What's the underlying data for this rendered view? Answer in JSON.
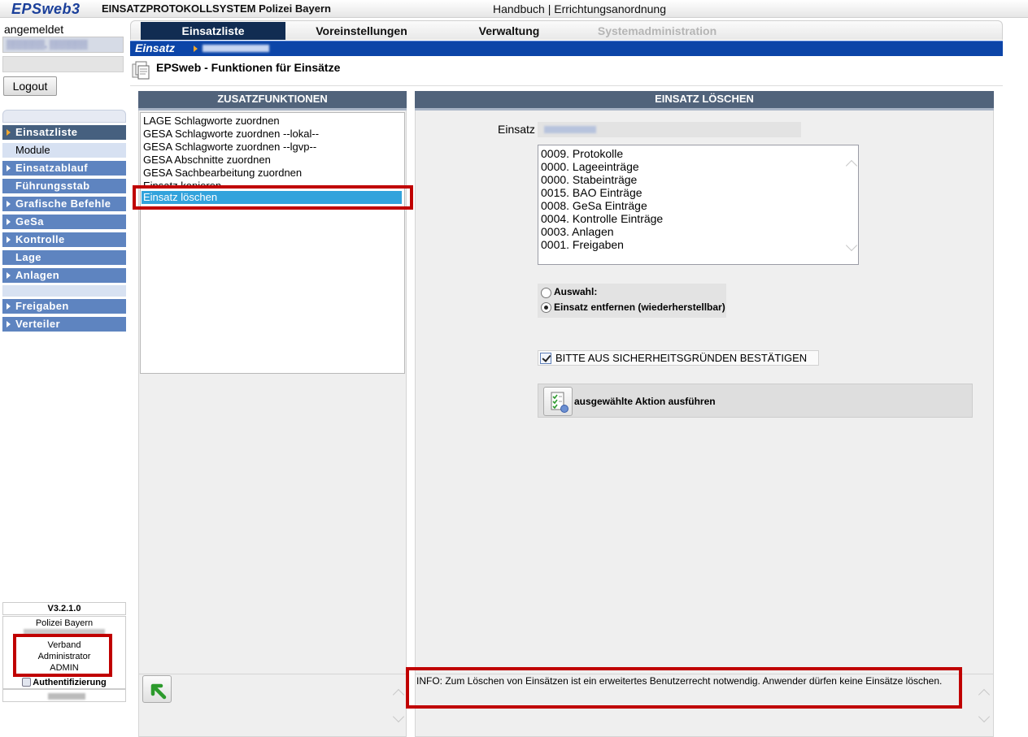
{
  "header": {
    "logo": "EPSweb3",
    "system_title": "EINSATZPROTOKOLLSYSTEM Polizei Bayern",
    "link_handbuch": "Handbuch",
    "link_separator": " | ",
    "link_errichtung": "Errichtungsanordnung"
  },
  "sidebar": {
    "login_label": "angemeldet",
    "logout_label": "Logout",
    "nav": [
      {
        "label": "Einsatzliste"
      },
      {
        "label": "Module"
      },
      {
        "label": "Einsatzablauf"
      },
      {
        "label": "Führungsstab"
      },
      {
        "label": "Grafische Befehle"
      },
      {
        "label": "GeSa"
      },
      {
        "label": "Kontrolle"
      },
      {
        "label": "Lage"
      },
      {
        "label": "Anlagen"
      },
      {
        "label": "Freigaben"
      },
      {
        "label": "Verteiler"
      }
    ],
    "version": "V3.2.1.0",
    "org": "Polizei Bayern",
    "roles": [
      "Verband",
      "Administrator",
      "ADMIN"
    ],
    "auth_label": "Authentifizierung"
  },
  "tabs": {
    "einsatzliste": "Einsatzliste",
    "voreinstellungen": "Voreinstellungen",
    "verwaltung": "Verwaltung",
    "systemadministration": "Systemadministration"
  },
  "breadcrumb": {
    "einsatz": "Einsatz"
  },
  "page": {
    "title": "EPSweb - Funktionen für Einsätze"
  },
  "left_panel": {
    "header": "ZUSATZFUNKTIONEN",
    "functions": [
      "LAGE Schlagworte zuordnen",
      "GESA Schlagworte zuordnen --lokal--",
      "GESA Schlagworte zuordnen --lgvp--",
      "GESA Abschnitte zuordnen",
      "GESA Sachbearbeitung zuordnen",
      "Einsatz kopieren",
      "Einsatz löschen"
    ]
  },
  "right_panel": {
    "header": "EINSATZ LÖSCHEN",
    "einsatz_label": "Einsatz",
    "counts": [
      "0009. Protokolle",
      "0000. Lageeinträge",
      "0000. Stabeinträge",
      "0015. BAO Einträge",
      "0008. GeSa Einträge",
      "0004. Kontrolle Einträge",
      "0003. Anlagen",
      "0001. Freigaben"
    ],
    "radio_auswahl": "Auswahl:",
    "radio_entfernen": "Einsatz entfernen (wiederherstellbar)",
    "confirm_label": "BITTE AUS SICHERHEITSGRÜNDEN BESTÄTIGEN",
    "execute_label": "ausgewählte Aktion ausführen"
  },
  "info": {
    "text": "INFO: Zum Löschen von Einsätzen ist ein erweitertes Benutzerrecht notwendig. Anwender dürfen keine Einsätze löschen."
  },
  "colors": {
    "nav_blue": "#5e84c0",
    "nav_active": "#46607f",
    "panel_header": "#51637b",
    "tab_active": "#112c52",
    "crumb_bar": "#0c45a8",
    "selected_item": "#32a3dc",
    "highlight_red": "#c00000"
  },
  "icons": {
    "page": "documents-icon",
    "execute": "checklist-execute-icon",
    "back": "green-arrow-back-icon",
    "auth": "key-icon"
  }
}
